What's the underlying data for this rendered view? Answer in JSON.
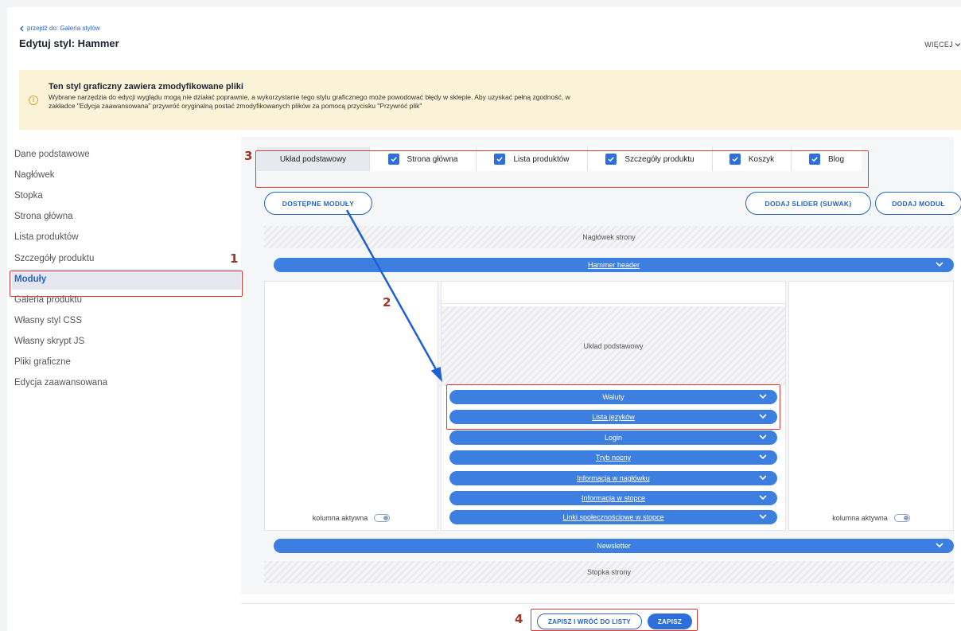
{
  "header": {
    "back_link": "przejdź do: Galeria stylów",
    "title": "Edytuj styl: Hammer",
    "more": "WIĘCEJ"
  },
  "warning": {
    "title": "Ten styl graficzny zawiera zmodyfikowane pliki",
    "text": "Wybrane narzędzia do edycji wyglądu mogą nie działać poprawnie, a wykorzystanie tego stylu graficznego może powodować błędy w sklepie. Aby uzyskać pełną zgodność, w zakładce \"Edycja zaawansowana\" przywróć oryginalną postać zmodyfikowanych plików za pomocą przycisku \"Przywróć plik\"",
    "icon": "info-circle-icon"
  },
  "sidebar": {
    "items": [
      {
        "label": "Dane podstawowe"
      },
      {
        "label": "Nagłówek"
      },
      {
        "label": "Stopka"
      },
      {
        "label": "Strona główna"
      },
      {
        "label": "Lista produktów"
      },
      {
        "label": "Szczegóły produktu"
      },
      {
        "label": "Moduły",
        "active": true
      },
      {
        "label": "Galeria produktu"
      },
      {
        "label": "Własny styl CSS"
      },
      {
        "label": "Własny skrypt JS"
      },
      {
        "label": "Pliki graficzne"
      },
      {
        "label": "Edycja zaawansowana"
      }
    ]
  },
  "tabs": [
    {
      "label": "Układ podstawowy",
      "checked": false,
      "active": true
    },
    {
      "label": "Strona główna",
      "checked": true
    },
    {
      "label": "Lista produktów",
      "checked": true
    },
    {
      "label": "Szczegóły produktu",
      "checked": true
    },
    {
      "label": "Koszyk",
      "checked": true
    },
    {
      "label": "Blog",
      "checked": true
    }
  ],
  "buttons": {
    "available_modules": "DOSTĘPNE MODUŁY",
    "add_slider": "DODAJ SLIDER (SUWAK)",
    "add_module": "DODAJ MODUŁ",
    "save_and_back": "ZAPISZ I WRÓĆ DO LISTY",
    "save": "ZAPISZ"
  },
  "layout": {
    "header_zone": "Nagłówek strony",
    "header_module": "Hammer header",
    "center_zone": "Układ podstawowy",
    "center_modules": [
      {
        "label": "Waluty",
        "link": false
      },
      {
        "label": "Lista języków",
        "link": true
      },
      {
        "label": "Login",
        "link": false
      },
      {
        "label": "Tryb nocny",
        "link": true
      },
      {
        "label": "Informacja w nagłówku",
        "link": true
      },
      {
        "label": "Informacja w stopce",
        "link": true
      },
      {
        "label": "Linki społecznościowe w stopce",
        "link": true
      }
    ],
    "column_active_label": "kolumna aktywna",
    "newsletter": "Newsletter",
    "footer_zone": "Stopka strony"
  },
  "annotations": [
    "1",
    "2",
    "3",
    "4"
  ],
  "colors": {
    "accent": "#2a64c4",
    "pill": "#3d7fe0",
    "annotation_red": "#d93a3a",
    "annotation_arrow": "#1f5fd6",
    "warning_bg": "#fbf3d8"
  }
}
